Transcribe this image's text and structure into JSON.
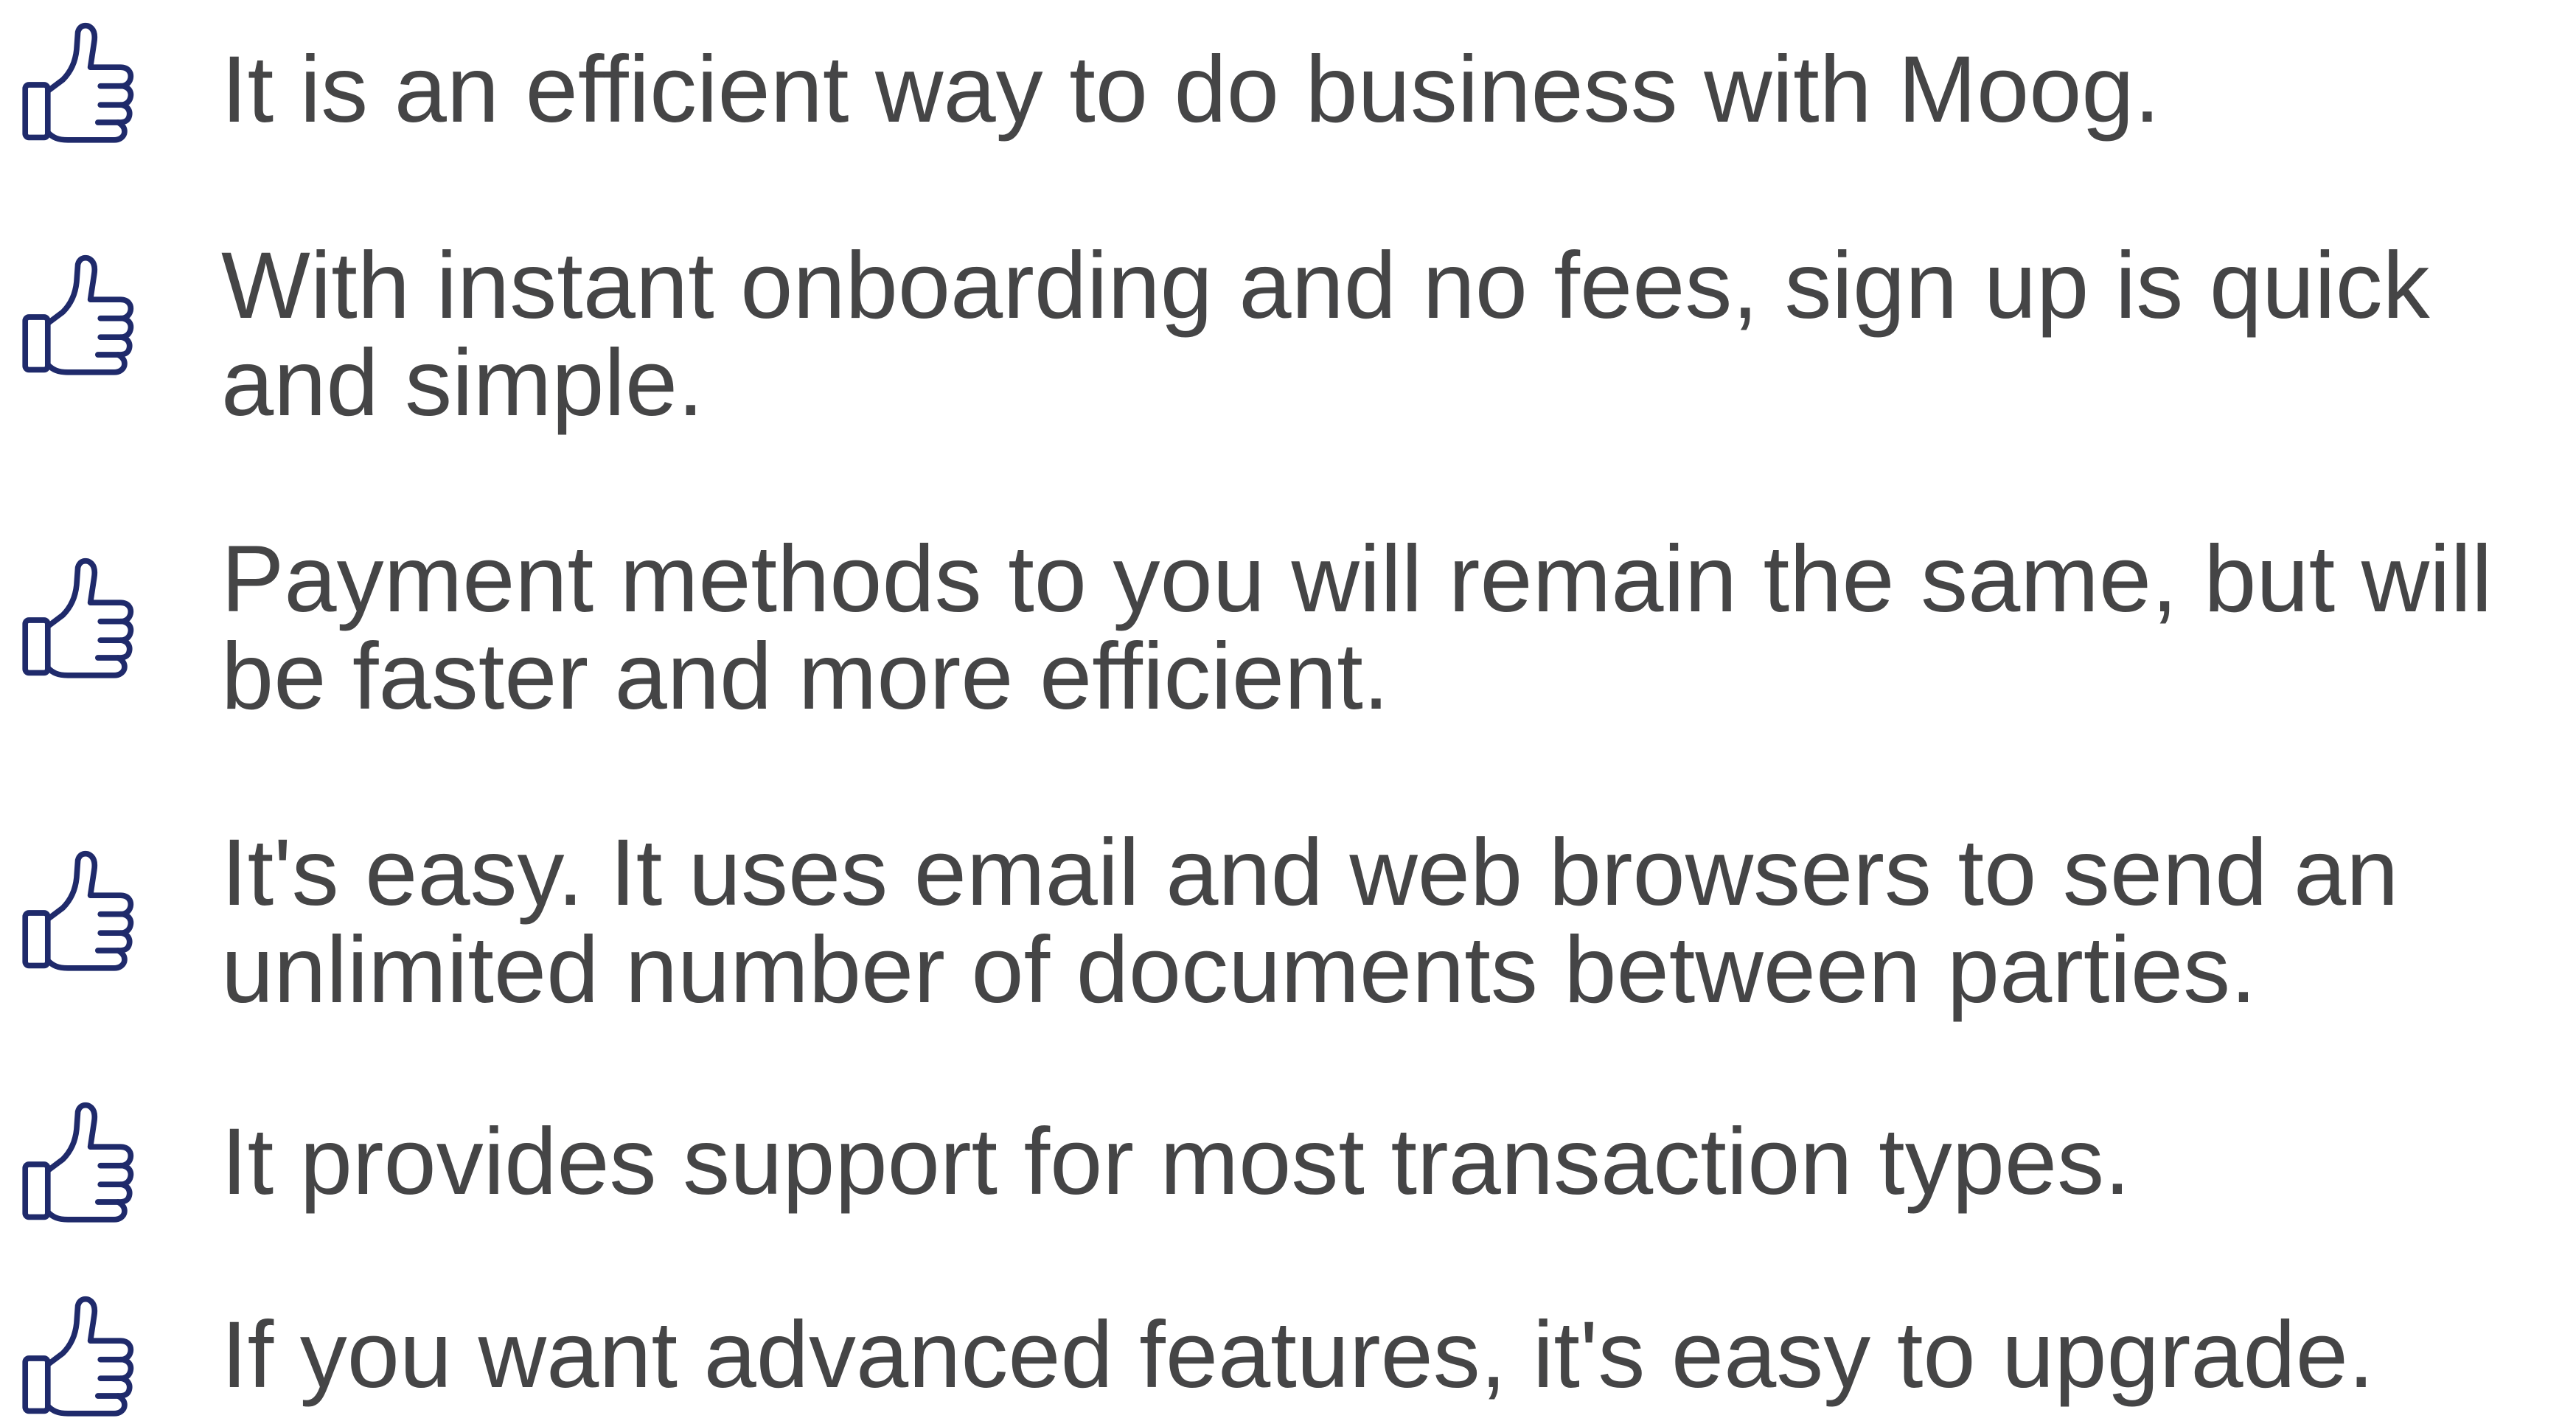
{
  "accent_color": "#1f2a6b",
  "text_color": "#454546",
  "benefits": {
    "icon": "thumbs-up-icon",
    "items": [
      {
        "text": "It is an efficient way to do business with Moog."
      },
      {
        "text": "With instant onboarding and no fees, sign up is quick\nand simple."
      },
      {
        "text": "Payment methods to you will remain the same, but will\nbe faster and more efficient."
      },
      {
        "text": "It's easy. It uses email and web browsers to send an\nunlimited number of documents between parties."
      },
      {
        "text": "It provides support for most transaction types."
      },
      {
        "text": "If you want advanced features, it's easy to upgrade."
      }
    ]
  }
}
